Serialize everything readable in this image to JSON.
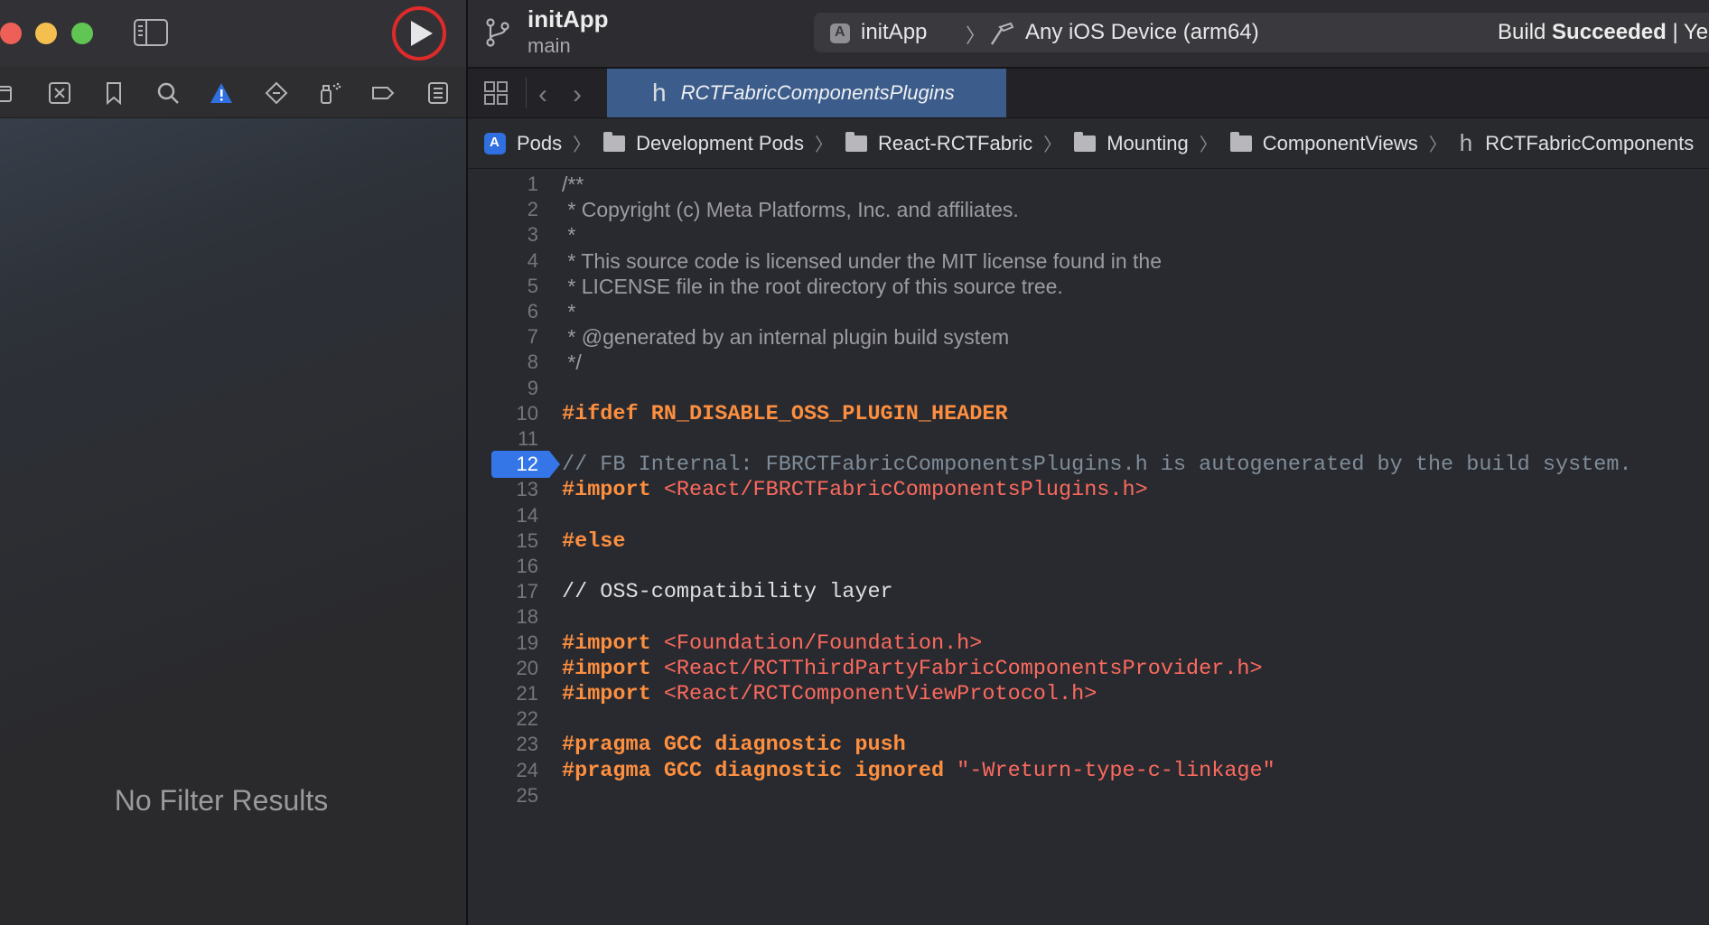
{
  "navigator": {
    "empty_message": "No Filter Results",
    "icons": [
      "folder-icon",
      "source-control-icon",
      "bookmark-icon",
      "find-icon",
      "issue-warning-icon",
      "test-icon",
      "debug-icon",
      "breakpoint-icon",
      "report-icon"
    ]
  },
  "toolbar": {
    "project": "initApp",
    "branch": "main",
    "scheme": "initApp",
    "scheme_separator": "〉",
    "destination": "Any iOS Device (arm64)",
    "build_status_prefix": "Build ",
    "build_status_strong": "Succeeded",
    "build_status_suffix": " | Yes"
  },
  "tabs": {
    "active_label": "RCTFabricComponentsPlugins",
    "active_type": "h"
  },
  "breadcrumb": [
    {
      "label": "Pods",
      "icon": "project-icon"
    },
    {
      "label": "Development Pods",
      "icon": "folder-icon"
    },
    {
      "label": "React-RCTFabric",
      "icon": "folder-icon"
    },
    {
      "label": "Mounting",
      "icon": "folder-icon"
    },
    {
      "label": "ComponentViews",
      "icon": "folder-icon"
    },
    {
      "label": "RCTFabricComponents",
      "icon": "header-file-icon"
    }
  ],
  "editor": {
    "current_line": 12,
    "lines": [
      {
        "n": "1",
        "segs": [
          {
            "t": "/**",
            "c": "star"
          }
        ]
      },
      {
        "n": "2",
        "segs": [
          {
            "t": " * ",
            "c": "star"
          },
          {
            "t": "Copyright (c) Meta Platforms, Inc. and affiliates.",
            "c": "doc"
          }
        ]
      },
      {
        "n": "3",
        "segs": [
          {
            "t": " *",
            "c": "star"
          }
        ]
      },
      {
        "n": "4",
        "segs": [
          {
            "t": " * ",
            "c": "star"
          },
          {
            "t": "This source code is licensed under the MIT license found in the",
            "c": "doc"
          }
        ]
      },
      {
        "n": "5",
        "segs": [
          {
            "t": " * ",
            "c": "star"
          },
          {
            "t": "LICENSE file in the root directory of this source tree.",
            "c": "doc"
          }
        ]
      },
      {
        "n": "6",
        "segs": [
          {
            "t": " *",
            "c": "star"
          }
        ]
      },
      {
        "n": "7",
        "segs": [
          {
            "t": " * ",
            "c": "star"
          },
          {
            "t": "@generated by an internal plugin build system",
            "c": "doc"
          }
        ]
      },
      {
        "n": "8",
        "segs": [
          {
            "t": " */",
            "c": "star"
          }
        ]
      },
      {
        "n": "9",
        "segs": []
      },
      {
        "n": "10",
        "segs": [
          {
            "t": "#ifdef RN_DISABLE_OSS_PLUGIN_HEADER",
            "c": "kw"
          }
        ]
      },
      {
        "n": "11",
        "segs": []
      },
      {
        "n": "12",
        "segs": [
          {
            "t": "// FB Internal: FBRCTFabricComponentsPlugins.h is autogenerated by the build system.",
            "c": "comment"
          }
        ]
      },
      {
        "n": "13",
        "segs": [
          {
            "t": "#import ",
            "c": "kw"
          },
          {
            "t": "<React/FBRCTFabricComponentsPlugins.h>",
            "c": "str"
          }
        ]
      },
      {
        "n": "14",
        "segs": []
      },
      {
        "n": "15",
        "segs": [
          {
            "t": "#else",
            "c": "kw"
          }
        ]
      },
      {
        "n": "16",
        "segs": []
      },
      {
        "n": "17",
        "segs": [
          {
            "t": "// OSS-compatibility layer",
            "c": "comment-plain"
          }
        ]
      },
      {
        "n": "18",
        "segs": []
      },
      {
        "n": "19",
        "segs": [
          {
            "t": "#import ",
            "c": "kw"
          },
          {
            "t": "<Foundation/Foundation.h>",
            "c": "str"
          }
        ]
      },
      {
        "n": "20",
        "segs": [
          {
            "t": "#import ",
            "c": "kw"
          },
          {
            "t": "<React/RCTThirdPartyFabricComponentsProvider.h>",
            "c": "str"
          }
        ]
      },
      {
        "n": "21",
        "segs": [
          {
            "t": "#import ",
            "c": "kw"
          },
          {
            "t": "<React/RCTComponentViewProtocol.h>",
            "c": "str"
          }
        ]
      },
      {
        "n": "22",
        "segs": []
      },
      {
        "n": "23",
        "segs": [
          {
            "t": "#pragma GCC diagnostic push",
            "c": "kw"
          }
        ]
      },
      {
        "n": "24",
        "segs": [
          {
            "t": "#pragma GCC diagnostic ignored ",
            "c": "kw"
          },
          {
            "t": "\"-Wreturn-type-c-linkage\"",
            "c": "str"
          }
        ]
      },
      {
        "n": "25",
        "segs": []
      }
    ]
  },
  "colors": {
    "keyword": "#fd8f3f",
    "string": "#fc6a5d",
    "comment": "#7f8c98",
    "current_line_marker": "#3476e8",
    "active_tab": "#3c5d8c",
    "run_highlight": "#e02a2a"
  }
}
